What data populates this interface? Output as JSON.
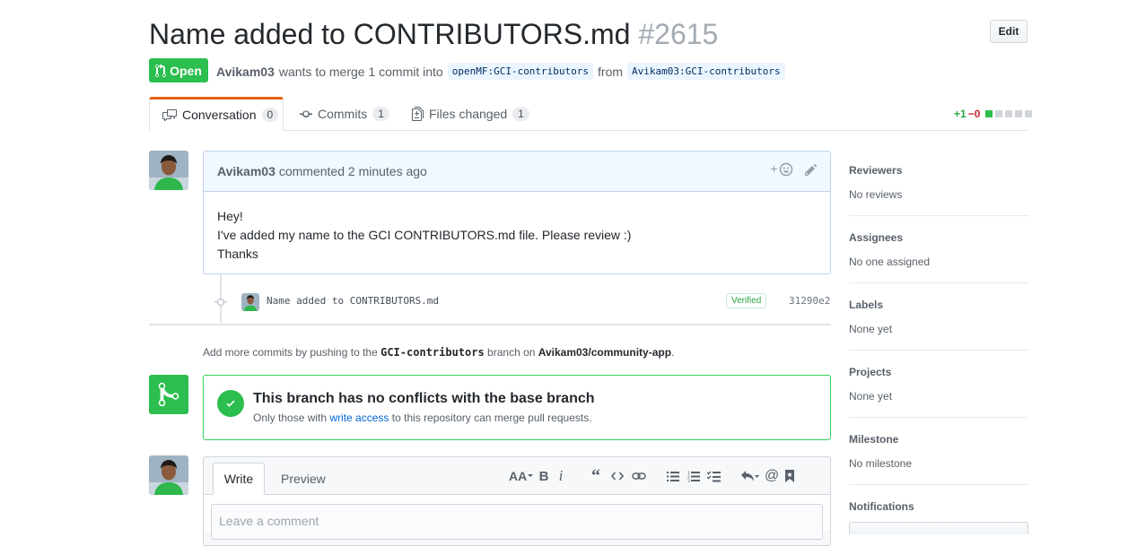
{
  "pr": {
    "title": "Name added to CONTRIBUTORS.md",
    "number": "#2615",
    "edit_label": "Edit",
    "state": "Open",
    "author": "Avikam03",
    "merge_text": "wants to merge 1 commit into",
    "base_branch": "openMF:GCI-contributors",
    "from_text": "from",
    "head_branch": "Avikam03:GCI-contributors"
  },
  "tabs": [
    {
      "label": "Conversation",
      "count": "0"
    },
    {
      "label": "Commits",
      "count": "1"
    },
    {
      "label": "Files changed",
      "count": "1"
    }
  ],
  "diffstat": {
    "additions": "+1",
    "deletions": "−0"
  },
  "comment": {
    "author": "Avikam03",
    "time_text": "commented 2 minutes ago",
    "lines": [
      "Hey!",
      "I've added my name to the GCI CONTRIBUTORS.md file. Please review :)",
      "Thanks"
    ]
  },
  "commit": {
    "message": "Name added to CONTRIBUTORS.md",
    "verified": "Verified",
    "sha": "31290e2"
  },
  "push_note": {
    "prefix": "Add more commits by pushing to the",
    "branch": "GCI-contributors",
    "middle": "branch on",
    "repo": "Avikam03/community-app",
    "suffix": "."
  },
  "merge": {
    "title": "This branch has no conflicts with the base branch",
    "sub_prefix": "Only those with",
    "sub_link": "write access",
    "sub_suffix": "to this repository can merge pull requests."
  },
  "editor": {
    "write_tab": "Write",
    "preview_tab": "Preview",
    "placeholder": "Leave a comment"
  },
  "sidebar": [
    {
      "heading": "Reviewers",
      "value": "No reviews"
    },
    {
      "heading": "Assignees",
      "value": "No one assigned"
    },
    {
      "heading": "Labels",
      "value": "None yet"
    },
    {
      "heading": "Projects",
      "value": "None yet"
    },
    {
      "heading": "Milestone",
      "value": "No milestone"
    },
    {
      "heading": "Notifications",
      "value": ""
    }
  ],
  "colors": {
    "open_green": "#2cbe4e",
    "link_blue": "#0366d6",
    "tab_accent": "#e36209"
  }
}
